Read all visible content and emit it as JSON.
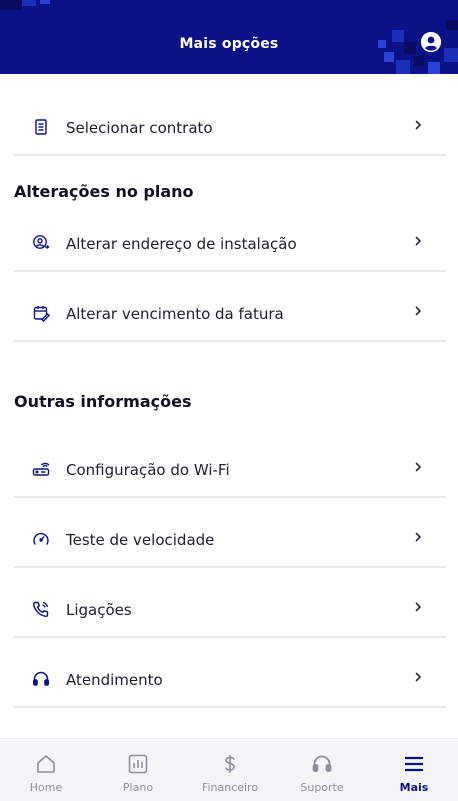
{
  "header": {
    "title": "Mais opções",
    "profile_icon": "user-circle-icon"
  },
  "contract": {
    "label": "Selecionar contrato",
    "icon": "document-icon"
  },
  "plan_changes": {
    "title": "Alterações no plano",
    "items": [
      {
        "label": "Alterar endereço de instalação",
        "icon": "location-person-icon"
      },
      {
        "label": "Alterar vencimento da fatura",
        "icon": "calendar-edit-icon"
      }
    ]
  },
  "other_info": {
    "title": "Outras informações",
    "items": [
      {
        "label": "Configuração do Wi-Fi",
        "icon": "router-icon"
      },
      {
        "label": "Teste de velocidade",
        "icon": "speedometer-icon"
      },
      {
        "label": "Ligações",
        "icon": "phone-icon"
      },
      {
        "label": "Atendimento",
        "icon": "headset-icon"
      }
    ]
  },
  "tabbar": {
    "items": [
      {
        "label": "Home",
        "icon": "home-icon",
        "active": false
      },
      {
        "label": "Plano",
        "icon": "chart-icon",
        "active": false
      },
      {
        "label": "Financeiro",
        "icon": "dollar-icon",
        "active": false
      },
      {
        "label": "Suporte",
        "icon": "headset-icon",
        "active": false
      },
      {
        "label": "Mais",
        "icon": "menu-icon",
        "active": true
      }
    ]
  },
  "colors": {
    "primary": "#0b1288",
    "inactive": "#8f8f9c",
    "divider": "#e7e7ec"
  }
}
